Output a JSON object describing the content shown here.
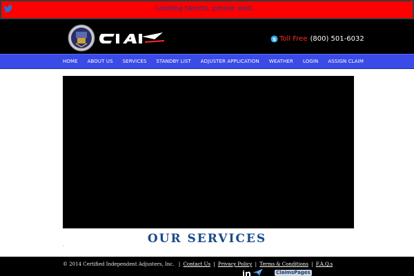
{
  "twitter": {
    "loading_text": "Loading tweets, please wait...",
    "icon": "twitter-bird-icon"
  },
  "header": {
    "brand_text": "CIAI",
    "phone": {
      "label": "Toll Free",
      "number": "(800) 501-6032",
      "icon": "skype-icon"
    }
  },
  "nav": {
    "items": [
      {
        "label": "HOME"
      },
      {
        "label": "ABOUT US"
      },
      {
        "label": "SERVICES"
      },
      {
        "label": "STANDBY LIST"
      },
      {
        "label": "ADJUSTER APPLICATION"
      },
      {
        "label": "WEATHER"
      },
      {
        "label": "LOGIN"
      },
      {
        "label": "ASSIGN CLAIM"
      }
    ]
  },
  "main": {
    "section_title": "OUR  SERVICES"
  },
  "footer": {
    "copyright": "© 2014 Certified Independent Adjusters, Inc.",
    "links": [
      {
        "label": "Contact Us"
      },
      {
        "label": "Privacy Policy"
      },
      {
        "label": "Terms & Conditions"
      },
      {
        "label": "F.A.Q.s"
      }
    ],
    "claims_logo_text": "ClaimsPages"
  },
  "colors": {
    "tweet_bar": "#ff0000",
    "header_bg": "#000000",
    "nav_bg": "#3a4be8",
    "section_title": "#1a4a8a",
    "toll_free": "#ff2a2a"
  }
}
